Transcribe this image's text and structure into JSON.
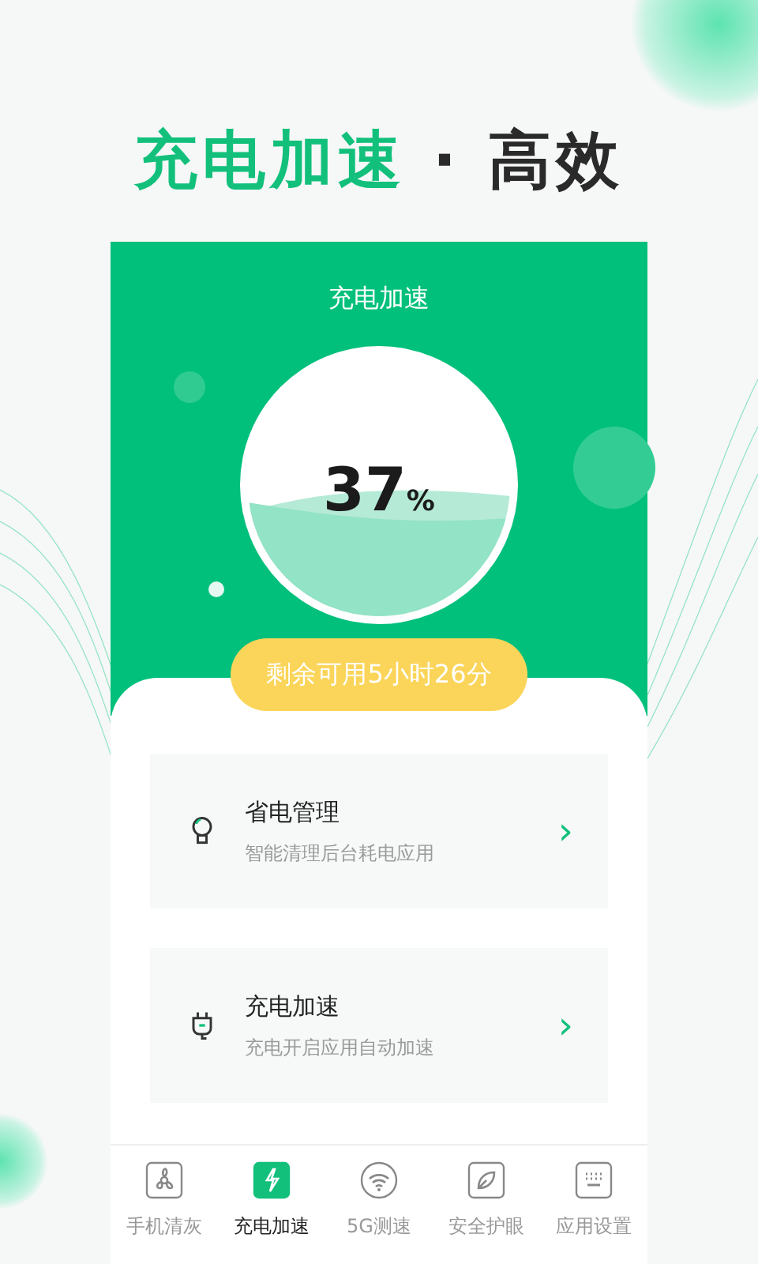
{
  "headline": {
    "highlight": "充电加速",
    "separator": "·",
    "rest": "高效"
  },
  "screen": {
    "title": "充电加速",
    "battery": {
      "percent": "37",
      "unit": "%"
    },
    "remaining": "剩余可用5小时26分"
  },
  "features": [
    {
      "kind": "bulb",
      "title": "省电管理",
      "subtitle": "智能清理后台耗电应用",
      "chevron": "›"
    },
    {
      "kind": "plug",
      "title": "充电加速",
      "subtitle": "充电开启应用自动加速",
      "chevron": "›"
    }
  ],
  "nav": [
    {
      "kind": "fan",
      "label": "手机清灰",
      "selected": false
    },
    {
      "kind": "bolt",
      "label": "充电加速",
      "selected": true
    },
    {
      "kind": "wifi",
      "label": "5G测速",
      "selected": false
    },
    {
      "kind": "leaf",
      "label": "安全护眼",
      "selected": false
    },
    {
      "kind": "keyboard",
      "label": "应用设置",
      "selected": false
    }
  ]
}
